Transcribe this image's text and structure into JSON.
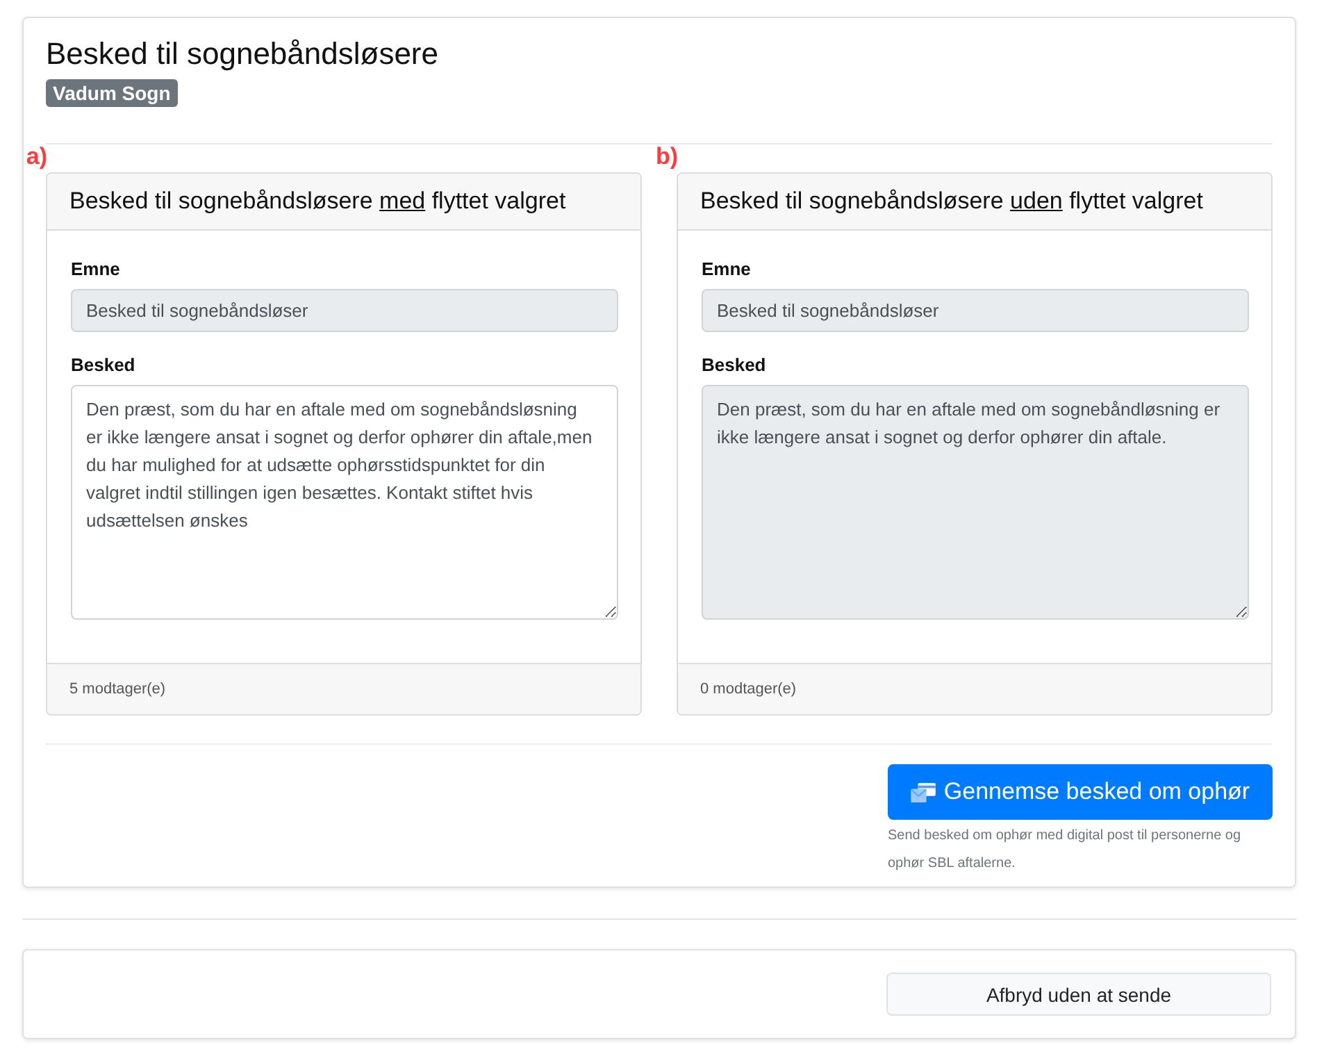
{
  "page": {
    "title": "Besked til sognebåndsløsere",
    "badge": "Vadum Sogn"
  },
  "panels": [
    {
      "annotation": "a)",
      "title": "Besked til sognebåndsløsere **med** flyttet valgret",
      "fields": [
        {
          "kind": "input",
          "label": "Emne",
          "value": "Besked til sognebåndsløser",
          "disabled": true
        },
        {
          "kind": "textarea",
          "label": "Besked",
          "value": "Den præst, som du har en aftale med om sognebåndsløsning er ikke længere ansat i sognet og derfor ophører din aftale,men du har mulighed for at udsætte ophørsstidspunktet for din valgret indtil stillingen igen besættes. Kontakt stiftet hvis udsættelsen ønskes",
          "disabled": false
        }
      ],
      "footer": "5 modtager(e)"
    },
    {
      "annotation": "b)",
      "title": "Besked til sognebåndsløsere **uden** flyttet valgret",
      "fields": [
        {
          "kind": "input",
          "label": "Emne",
          "value": "Besked til sognebåndsløser",
          "disabled": true
        },
        {
          "kind": "textarea",
          "label": "Besked",
          "value": "Den præst, som du har en aftale med om sognebåndløsning er ikke længere ansat i sognet og derfor ophører din aftale.",
          "disabled": true
        }
      ],
      "footer": "0 modtager(e)"
    }
  ],
  "send_action": {
    "button": "Gennemse besked om ophør",
    "help": "Send besked om ophør med digital post til personerne og ophør SBL aftalerne."
  },
  "cancel_button": "Afbryd uden at sende"
}
